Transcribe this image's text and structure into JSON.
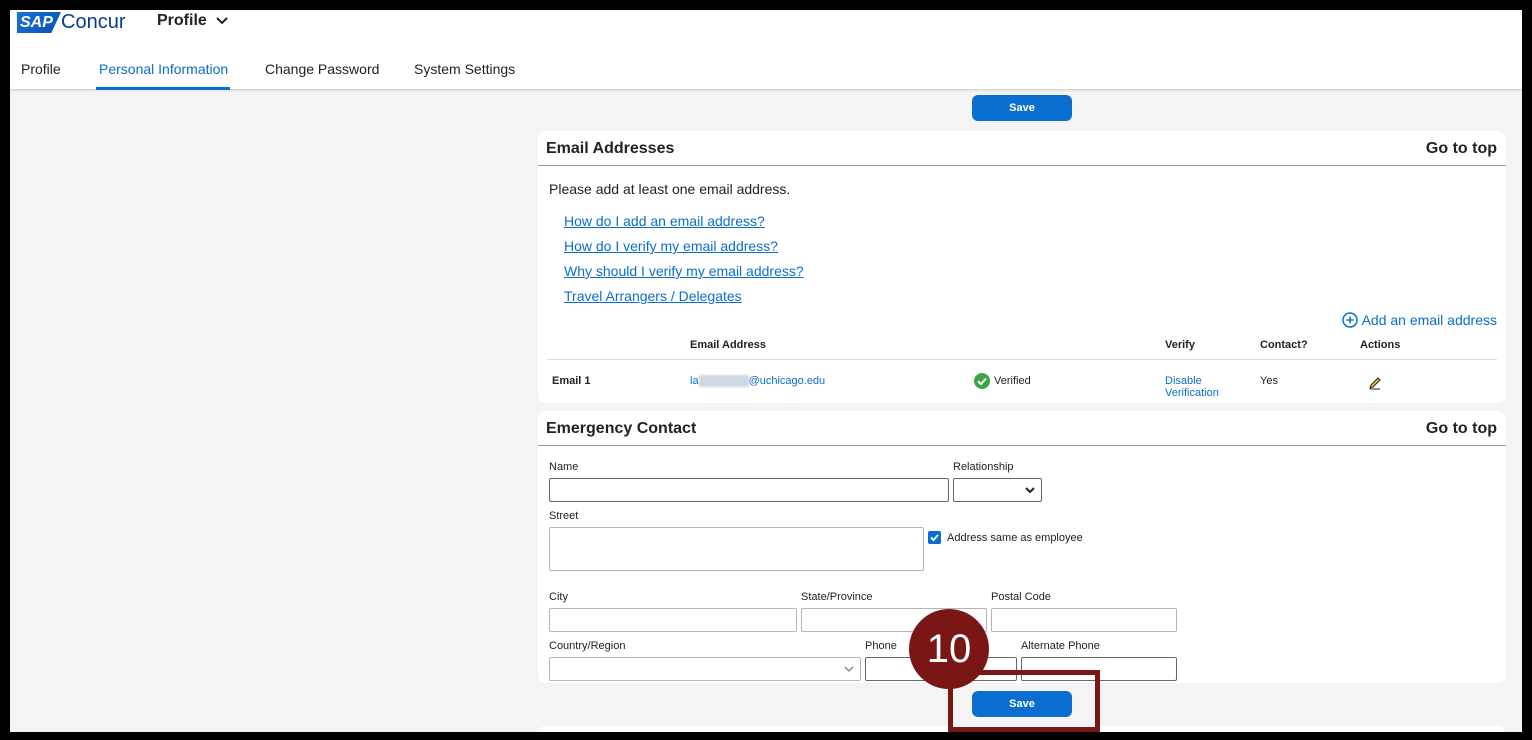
{
  "header": {
    "logo_sap": "SAP",
    "logo_concur": "Concur",
    "app_title": "Profile",
    "tabs": [
      {
        "label": "Profile"
      },
      {
        "label": "Personal Information",
        "active": true
      },
      {
        "label": "Change Password"
      },
      {
        "label": "System Settings"
      }
    ]
  },
  "actions": {
    "save_label": "Save"
  },
  "email_section": {
    "title": "Email Addresses",
    "go_to_top": "Go to top",
    "instruction": "Please add at least one email address.",
    "help_links": [
      "How do I add an email address?",
      "How do I verify my email address?",
      "Why should I verify my email address?",
      "Travel Arrangers / Delegates"
    ],
    "add_label": "Add an email address",
    "table": {
      "headers": {
        "email": "Email Address",
        "verify": "Verify",
        "contact": "Contact?",
        "actions": "Actions"
      },
      "rows": [
        {
          "label": "Email 1",
          "email_prefix": "la",
          "email_domain": "@uchicago.edu",
          "status": "Verified",
          "verify_action_line1": "Disable",
          "verify_action_line2": "Verification",
          "contact": "Yes"
        }
      ]
    }
  },
  "emergency_section": {
    "title": "Emergency Contact",
    "go_to_top": "Go to top",
    "labels": {
      "name": "Name",
      "relationship": "Relationship",
      "street": "Street",
      "same_address": "Address same as employee",
      "city": "City",
      "state": "State/Province",
      "postal": "Postal Code",
      "country": "Country/Region",
      "phone": "Phone",
      "alt_phone": "Alternate Phone"
    },
    "values": {
      "name": "",
      "relationship": "",
      "street": "",
      "city": "",
      "state": "",
      "postal": "",
      "country": "",
      "phone": "",
      "alt_phone": ""
    },
    "same_address_checked": true
  },
  "annotation": {
    "step_number": "10",
    "color": "#7a1616"
  },
  "colors": {
    "accent": "#0a6ed1",
    "verified": "#3aa546",
    "annotation": "#7a1616"
  }
}
